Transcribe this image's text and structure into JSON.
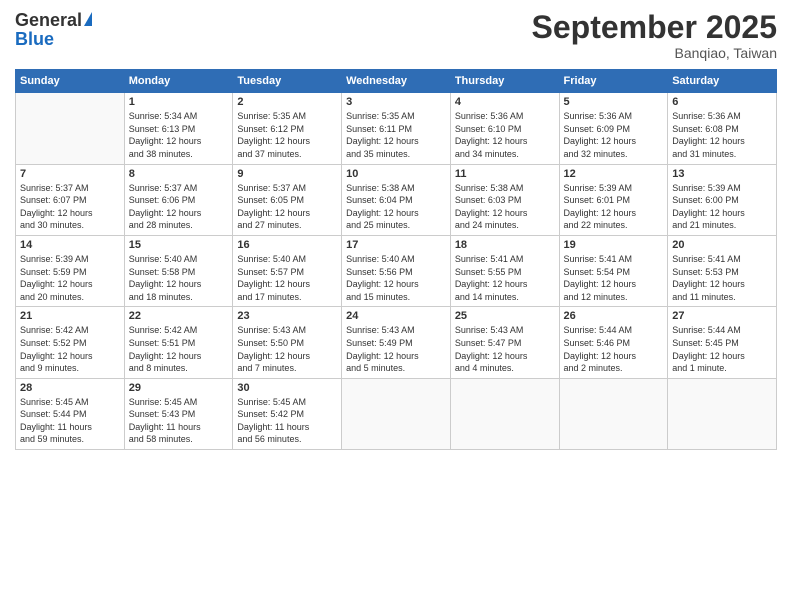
{
  "logo": {
    "general": "General",
    "blue": "Blue"
  },
  "header": {
    "title": "September 2025",
    "subtitle": "Banqiao, Taiwan"
  },
  "weekdays": [
    "Sunday",
    "Monday",
    "Tuesday",
    "Wednesday",
    "Thursday",
    "Friday",
    "Saturday"
  ],
  "weeks": [
    [
      {
        "day": "",
        "info": ""
      },
      {
        "day": "1",
        "info": "Sunrise: 5:34 AM\nSunset: 6:13 PM\nDaylight: 12 hours\nand 38 minutes."
      },
      {
        "day": "2",
        "info": "Sunrise: 5:35 AM\nSunset: 6:12 PM\nDaylight: 12 hours\nand 37 minutes."
      },
      {
        "day": "3",
        "info": "Sunrise: 5:35 AM\nSunset: 6:11 PM\nDaylight: 12 hours\nand 35 minutes."
      },
      {
        "day": "4",
        "info": "Sunrise: 5:36 AM\nSunset: 6:10 PM\nDaylight: 12 hours\nand 34 minutes."
      },
      {
        "day": "5",
        "info": "Sunrise: 5:36 AM\nSunset: 6:09 PM\nDaylight: 12 hours\nand 32 minutes."
      },
      {
        "day": "6",
        "info": "Sunrise: 5:36 AM\nSunset: 6:08 PM\nDaylight: 12 hours\nand 31 minutes."
      }
    ],
    [
      {
        "day": "7",
        "info": "Sunrise: 5:37 AM\nSunset: 6:07 PM\nDaylight: 12 hours\nand 30 minutes."
      },
      {
        "day": "8",
        "info": "Sunrise: 5:37 AM\nSunset: 6:06 PM\nDaylight: 12 hours\nand 28 minutes."
      },
      {
        "day": "9",
        "info": "Sunrise: 5:37 AM\nSunset: 6:05 PM\nDaylight: 12 hours\nand 27 minutes."
      },
      {
        "day": "10",
        "info": "Sunrise: 5:38 AM\nSunset: 6:04 PM\nDaylight: 12 hours\nand 25 minutes."
      },
      {
        "day": "11",
        "info": "Sunrise: 5:38 AM\nSunset: 6:03 PM\nDaylight: 12 hours\nand 24 minutes."
      },
      {
        "day": "12",
        "info": "Sunrise: 5:39 AM\nSunset: 6:01 PM\nDaylight: 12 hours\nand 22 minutes."
      },
      {
        "day": "13",
        "info": "Sunrise: 5:39 AM\nSunset: 6:00 PM\nDaylight: 12 hours\nand 21 minutes."
      }
    ],
    [
      {
        "day": "14",
        "info": "Sunrise: 5:39 AM\nSunset: 5:59 PM\nDaylight: 12 hours\nand 20 minutes."
      },
      {
        "day": "15",
        "info": "Sunrise: 5:40 AM\nSunset: 5:58 PM\nDaylight: 12 hours\nand 18 minutes."
      },
      {
        "day": "16",
        "info": "Sunrise: 5:40 AM\nSunset: 5:57 PM\nDaylight: 12 hours\nand 17 minutes."
      },
      {
        "day": "17",
        "info": "Sunrise: 5:40 AM\nSunset: 5:56 PM\nDaylight: 12 hours\nand 15 minutes."
      },
      {
        "day": "18",
        "info": "Sunrise: 5:41 AM\nSunset: 5:55 PM\nDaylight: 12 hours\nand 14 minutes."
      },
      {
        "day": "19",
        "info": "Sunrise: 5:41 AM\nSunset: 5:54 PM\nDaylight: 12 hours\nand 12 minutes."
      },
      {
        "day": "20",
        "info": "Sunrise: 5:41 AM\nSunset: 5:53 PM\nDaylight: 12 hours\nand 11 minutes."
      }
    ],
    [
      {
        "day": "21",
        "info": "Sunrise: 5:42 AM\nSunset: 5:52 PM\nDaylight: 12 hours\nand 9 minutes."
      },
      {
        "day": "22",
        "info": "Sunrise: 5:42 AM\nSunset: 5:51 PM\nDaylight: 12 hours\nand 8 minutes."
      },
      {
        "day": "23",
        "info": "Sunrise: 5:43 AM\nSunset: 5:50 PM\nDaylight: 12 hours\nand 7 minutes."
      },
      {
        "day": "24",
        "info": "Sunrise: 5:43 AM\nSunset: 5:49 PM\nDaylight: 12 hours\nand 5 minutes."
      },
      {
        "day": "25",
        "info": "Sunrise: 5:43 AM\nSunset: 5:47 PM\nDaylight: 12 hours\nand 4 minutes."
      },
      {
        "day": "26",
        "info": "Sunrise: 5:44 AM\nSunset: 5:46 PM\nDaylight: 12 hours\nand 2 minutes."
      },
      {
        "day": "27",
        "info": "Sunrise: 5:44 AM\nSunset: 5:45 PM\nDaylight: 12 hours\nand 1 minute."
      }
    ],
    [
      {
        "day": "28",
        "info": "Sunrise: 5:45 AM\nSunset: 5:44 PM\nDaylight: 11 hours\nand 59 minutes."
      },
      {
        "day": "29",
        "info": "Sunrise: 5:45 AM\nSunset: 5:43 PM\nDaylight: 11 hours\nand 58 minutes."
      },
      {
        "day": "30",
        "info": "Sunrise: 5:45 AM\nSunset: 5:42 PM\nDaylight: 11 hours\nand 56 minutes."
      },
      {
        "day": "",
        "info": ""
      },
      {
        "day": "",
        "info": ""
      },
      {
        "day": "",
        "info": ""
      },
      {
        "day": "",
        "info": ""
      }
    ]
  ]
}
